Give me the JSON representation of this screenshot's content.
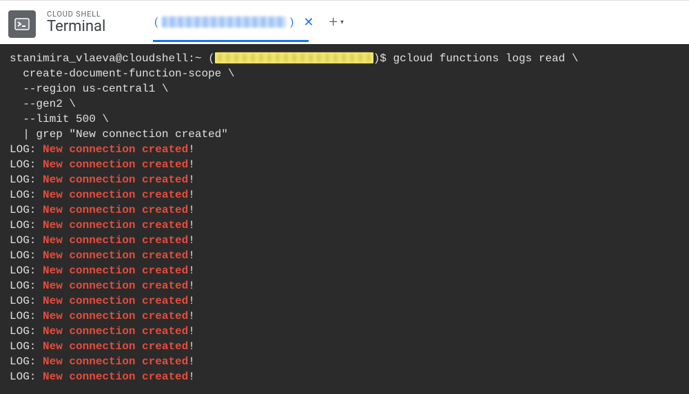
{
  "header": {
    "overline": "CLOUD SHELL",
    "title": "Terminal"
  },
  "tab": {
    "close_glyph": "✕"
  },
  "add": {
    "plus": "+",
    "caret": "▾"
  },
  "terminal": {
    "prompt_user": "stanimira_vlaeva@cloudshell",
    "prompt_sep": ":",
    "prompt_path": "~",
    "paren_open": "(",
    "paren_close": ")",
    "dollar": "$",
    "cmd_lines": [
      "gcloud functions logs read \\",
      "  create-document-function-scope \\",
      "  --region us-central1 \\",
      "  --gen2 \\",
      "  --limit 500 \\",
      "  | grep \"New connection created\""
    ],
    "log_prefix": "LOG:",
    "log_message": "New connection created",
    "log_bang": "!",
    "log_count": 16
  }
}
